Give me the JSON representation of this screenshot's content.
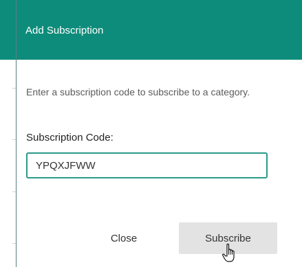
{
  "dialog": {
    "title": "Add Subscription",
    "description": "Enter a subscription code to subscribe to a category.",
    "field_label": "Subscription Code:",
    "code_value": "YPQXJFWW",
    "close_label": "Close",
    "subscribe_label": "Subscribe"
  },
  "colors": {
    "header": "#0e8c7b",
    "input_border": "#2a9a8a",
    "subscribe_bg": "#e3e3e3"
  },
  "cursor": {
    "icon": "hand-pointer-icon"
  }
}
